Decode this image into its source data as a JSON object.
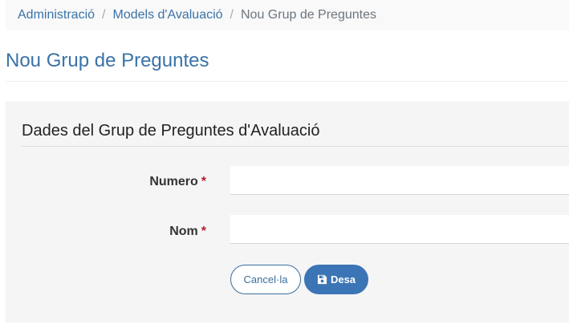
{
  "breadcrumb": {
    "items": [
      {
        "label": "Administració",
        "link": true
      },
      {
        "label": "Models d'Avaluació",
        "link": true
      },
      {
        "label": "Nou Grup de Preguntes",
        "link": false
      }
    ],
    "separator": "/"
  },
  "page": {
    "title": "Nou Grup de Preguntes"
  },
  "panel": {
    "heading": "Dades del Grup de Preguntes d'Avaluació"
  },
  "form": {
    "fields": [
      {
        "label": "Numero",
        "required_mark": "*",
        "value": "",
        "placeholder": ""
      },
      {
        "label": "Nom",
        "required_mark": "*",
        "value": "",
        "placeholder": ""
      }
    ],
    "cancel_label": "Cancel·la",
    "save_label": "Desa",
    "save_icon": "floppy-disk-icon"
  },
  "colors": {
    "accent": "#3a73a8",
    "primary_button": "#3b75b6",
    "required": "#b21f2d",
    "panel_background": "#f5f5f5"
  }
}
